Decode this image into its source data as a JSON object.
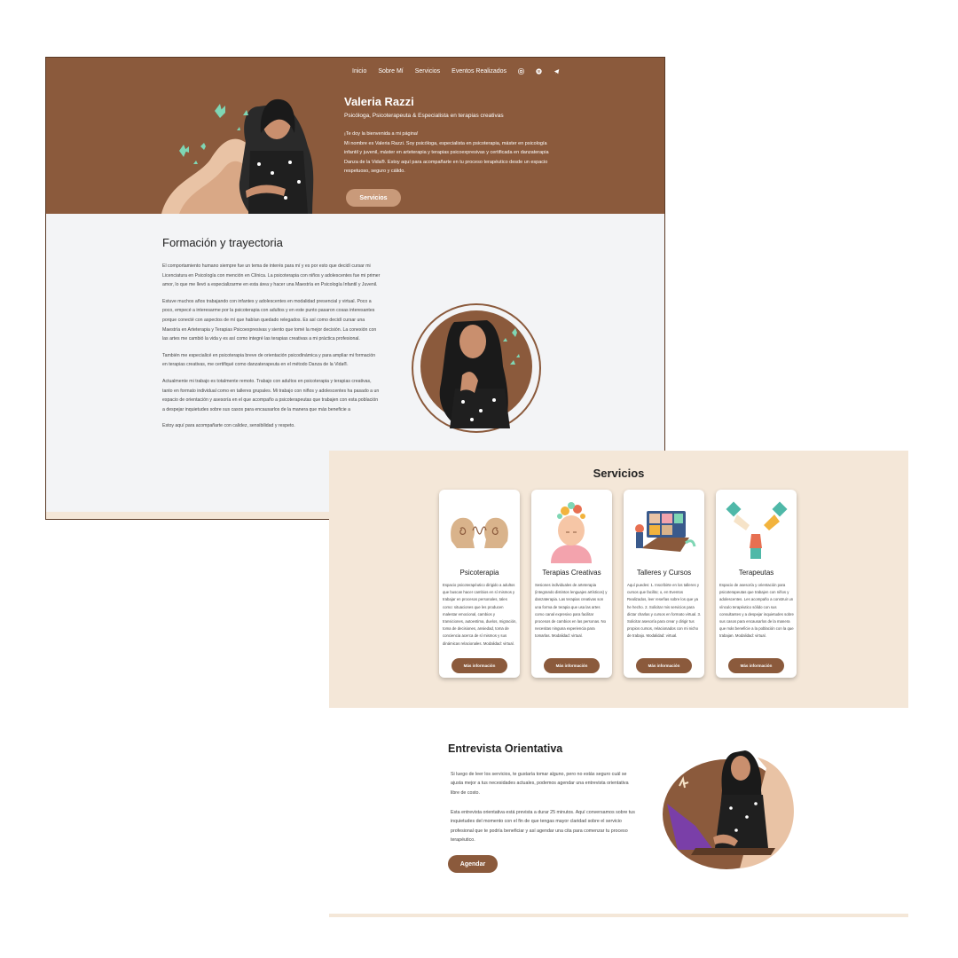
{
  "nav": {
    "items": [
      "Inicio",
      "Sobre Mí",
      "Servicios",
      "Eventos Realizados"
    ],
    "social_icons": [
      "instagram-icon",
      "spotify-icon",
      "telegram-icon"
    ]
  },
  "hero": {
    "name": "Valeria Razzi",
    "subtitle": "Psicóloga, Psicoterapeuta & Especialista en terapias creativas",
    "welcome": "¡Te doy la bienvenida a mi página!",
    "intro": "Mi nombre es Valeria Razzi. Soy psicóloga, especialista en psicoterapia, máster en psicología infantil y juvenil, máster en arteterapia y terapias psicoexpresivas y certificada en danzaterapia Danza de la Vida®. Estoy aquí para acompañarte en tu proceso terapéutico desde un espacio respetuoso, seguro y cálido.",
    "button": "Servicios"
  },
  "trayectoria": {
    "title": "Formación y trayectoria",
    "paragraphs": [
      "El comportamiento humano siempre fue un tema de interés para mí y es por esto que decidí cursar mi Licenciatura en Psicología con mención en Clínica. La psicoterapia con niños y adolescentes fue mi primer amor, lo que me llevó a especializarme en esta área y hacer una Maestría en Psicología Infantil y Juvenil.",
      "Estuve muchos años trabajando con infantes y adolescentes en modalidad presencial y virtual. Poco a poco, empecé a interesarme por la psicoterapia con adultos y en este punto pasaron cosas interesantes porque conecté con aspectos de mí que habían quedado relegados. Es así como decidí cursar una Maestría en Arteterapia y Terapias Psicoexpresivas y siento que tomé la mejor decisión. La conexión con las artes me cambió la vida y es así como integré las terapias creativas a mi práctica profesional.",
      "También me especialicé en psicoterapia breve de orientación psicodinámica y para ampliar mi formación en terapias creativas, me certifiqué como danzaterapeuta en el método Danza de la Vida®.",
      "Actualmente mi trabajo es totalmente remoto. Trabajo con adultos en psicoterapia y terapias creativas, tanto en formato individual como en talleres grupales. Mi trabajo con niños y adolescentes ha pasado a un espacio de orientación y asesoría en el que acompaño a psicoterapeutas que trabajen con esta población a despejar inquietudes sobre sus casos para encausarlos de la manera que más beneficie a",
      "Estoy aquí para acompañarte con calidez, sensibilidad y respeto."
    ]
  },
  "servicios": {
    "title": "Servicios",
    "cards": [
      {
        "name": "Psicoterapia",
        "desc": "Espacio psicoterapéutico dirigido a adultos que buscan hacer cambios en sí mismos y trabajar en procesos personales, tales como: situaciones que les producen malestar emocional, cambios y transiciones, autoestima, duelos, migración, toma de decisiones, ansiedad, toma de conciencia acerca de sí mismos y sus dinámicas relacionales. Modalidad: virtual.",
        "button": "Más información",
        "icon": "brain-heads-icon"
      },
      {
        "name": "Terapias Creativas",
        "desc": "Sesiones individuales de arteterapia (integrando distintos lenguajes artísticos) y danzaterapia. Las terapias creativas son una forma de terapia que usa las artes como canal expresivo para facilitar procesos de cambios en las personas. No necesitas ninguna experiencia para tomarlas. Modalidad: virtual.",
        "button": "Más información",
        "icon": "flower-mind-icon"
      },
      {
        "name": "Talleres y Cursos",
        "desc": "Aquí puedes: 1. Inscribirte en los talleres y cursos que facilito; o, en Eventos Realizados, leer reseñas sobre los que ya he hecho. 2. Solicitar mis servicios para dictar charlas y cursos en formato virtual. 3. Solicitar asesoría para crear y dirigir tus propios cursos, relacionados con mi nicho de trabajo. Modalidad: virtual.",
        "button": "Más información",
        "icon": "video-call-icon"
      },
      {
        "name": "Terapeutas",
        "desc": "Espacio de asesoría y orientación para psicoterapeutas que trabajen con niños y adolescentes. Les acompaño a construir un vínculo terapéutico sólido con sus consultantes y a despejar inquietudes sobre sus casos para encausarlos de la manera que más beneficie a la población con la que trabajan. Modalidad: virtual.",
        "button": "Más información",
        "icon": "helping-hands-icon"
      }
    ]
  },
  "entrevista": {
    "title": "Entrevista Orientativa",
    "p1": "Si luego de leer los servicios, te gustaría tomar alguno, pero no estás seguro cuál se ajusta mejor a tus necesidades actuales, podemos agendar una entrevista orientativa libre de costo.",
    "p2": "Esta entrevista orientativa está prevista a durar 25 minutos. Aquí conversamos sobre tus inquietudes del momento con el fin de que tengas mayor claridad sobre el servicio profesional que te podría beneficiar y así agendar una cita para comenzar tu proceso terapéutico.",
    "button": "Agendar"
  },
  "colors": {
    "brown": "#8b5a3c",
    "beige": "#f4e7d8",
    "mint": "#7fd6b4",
    "light_brown": "#c99a7a"
  }
}
